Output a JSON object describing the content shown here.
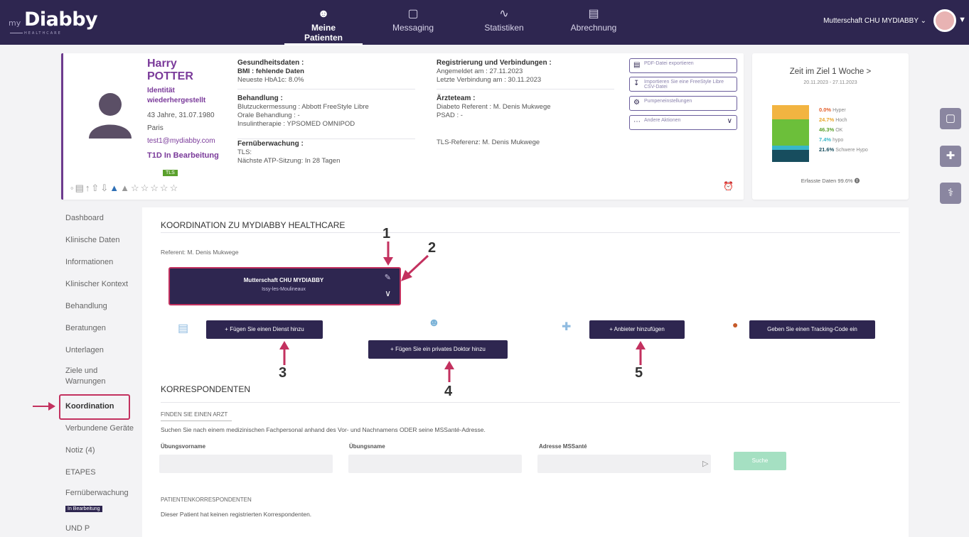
{
  "topbar": {
    "logo_my": "my",
    "logo_name": "Diabby",
    "logo_sub": "HEALTHCARE",
    "nav": [
      {
        "label": "Meine Patienten",
        "icon": "patients-icon"
      },
      {
        "label": "Messaging",
        "icon": "chat-icon"
      },
      {
        "label": "Statistiken",
        "icon": "chart-icon"
      },
      {
        "label": "Abrechnung",
        "icon": "invoice-icon"
      }
    ],
    "user": "Mutterschaft CHU MYDIABBY ⌄"
  },
  "patient": {
    "first": "Harry",
    "last": "POTTER",
    "identity": "Identität wiederhergestellt",
    "age": "43 Jahre, 31.07.1980",
    "city": "Paris",
    "email": "test1@mydiabby.com",
    "type": "T1D In Bearbeitung",
    "tls": "TLS"
  },
  "health": {
    "h1": "Gesundheitsdaten :",
    "bmi": "BMI : fehlende Daten",
    "hba1c": "Neueste HbA1c: 8.0%",
    "h2": "Behandlung :",
    "bz": "Blutzuckermessung : Abbott FreeStyle Libre",
    "oral": "Orale Behandlung : -",
    "insulin": "Insulintherapie : YPSOMED OMNIPOD",
    "h3": "Fernüberwachung :",
    "tls": "TLS:",
    "atp": "Nächste ATP-Sitzung: In 28 Tagen"
  },
  "reg": {
    "h1": "Registrierung und Verbindungen :",
    "created": "Angemeldet am : 27.11.2023",
    "last": "Letzte Verbindung am : 30.11.2023",
    "h2": "Ärzteteam :",
    "referent": "Diabeto Referent : M. Denis Mukwege",
    "psad": "PSAD : -",
    "tls_ref": "TLS-Referenz: M. Denis Mukwege"
  },
  "actions": [
    {
      "label": "PDF-Datei exportieren",
      "icon": "pdf-icon"
    },
    {
      "label": "Importieren Sie eine FreeStyle Libre CSV-Datei",
      "icon": "download-icon"
    },
    {
      "label": "Pumpeneinstellungen",
      "icon": "gear-icon"
    },
    {
      "label": "Andere Aktionen",
      "icon": "dots-icon"
    }
  ],
  "tir": {
    "title": "Zeit im Ziel 1 Woche >",
    "date": "20.11.2023 - 27.11.2023",
    "hyper2": "0.0%",
    "hyper2_lbl": "Hyper",
    "hyper": "24.7%",
    "hyper_lbl": "Hoch",
    "ok": "46.3%",
    "ok_lbl": "OK",
    "hypo": "7.4%",
    "hypo_lbl": "hypo",
    "hypo2": "21.6%",
    "hypo2_lbl": "Schwere Hypo",
    "foot": "Erfasste Daten   99.6% ⓿",
    "values": [
      0.0,
      24.7,
      46.3,
      7.4,
      21.6
    ],
    "colors": [
      "#f2b441",
      "#f2b441",
      "#6cbf3a",
      "#38b7c9",
      "#174d5e"
    ]
  },
  "sidebar": [
    "Dashboard",
    "Klinische Daten",
    "Informationen",
    "Klinischer Kontext",
    "Behandlung",
    "Beratungen",
    "Unterlagen",
    "Ziele und",
    "Warnungen",
    "Koordination",
    "Verbundene Geräte",
    "Notiz (4)",
    "ETAPES",
    "Fernüberwachung",
    "In Bearbeitung",
    "UND P"
  ],
  "main": {
    "title": "KOORDINATION ZU MYDIABBY HEALTHCARE",
    "referent": "Referent: M. Denis Mukwege",
    "org_name": "Mutterschaft CHU MYDIABBY",
    "org_city": "Issy-les-Moulineaux",
    "btn_service": "+  Fügen Sie einen Dienst hinzu",
    "btn_doctor": "+  Fügen Sie ein privates Doktor hinzu",
    "btn_provider": "+  Anbieter hinzufügen",
    "btn_tracking": "Geben Sie einen Tracking-Code ein",
    "ann": [
      "1",
      "2",
      "3",
      "4",
      "5"
    ],
    "corr_title": "KORRESPONDENTEN",
    "find_title": "FINDEN SIE EINEN ARZT",
    "hint": "Suchen Sie nach einem medizinischen Fachpersonal anhand des Vor- und Nachnamens ODER seine MSSanté-Adresse.",
    "lbl_first": "Übungsvorname",
    "lbl_last": "Übungsname",
    "lbl_mss": "Adresse MSSanté",
    "search": "Suche",
    "pk_title": "PATIENTENKORRESPONDENTEN",
    "pk_text": "Dieser Patient hat keinen registrierten Korrespondenten."
  }
}
